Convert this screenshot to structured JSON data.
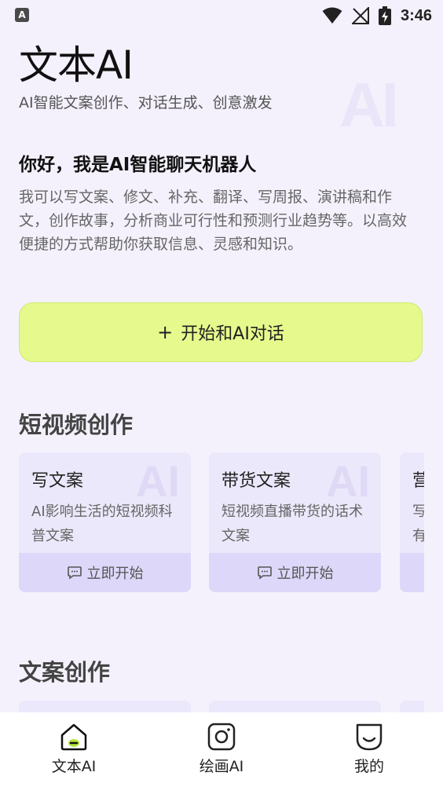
{
  "status_bar": {
    "app_icon": "A",
    "time": "3:46"
  },
  "header": {
    "title": "文本AI",
    "subtitle": "AI智能文案创作、对话生成、创意激发",
    "watermark": "AI"
  },
  "greeting": {
    "title": "你好，我是AI智能聊天机器人",
    "body": "我可以写文案、修文、补充、翻译、写周报、演讲稿和作文，创作故事，分析商业可行性和预测行业趋势等。以高效便捷的方式帮助你获取信息、灵感和知识。"
  },
  "start_chat": {
    "plus": "+",
    "label": "开始和AI对话"
  },
  "sections": [
    {
      "title": "短视频创作",
      "cards": [
        {
          "title": "写文案",
          "desc": "AI影响生活的短视频科普文案",
          "action": "立即开始"
        },
        {
          "title": "带货文案",
          "desc": "短视频直播带货的话术文案",
          "action": "立即开始"
        },
        {
          "title": "营",
          "desc": "写有",
          "action": ""
        }
      ]
    },
    {
      "title": "文案创作"
    }
  ],
  "bottom_nav": [
    {
      "label": "文本AI",
      "icon": "home-icon",
      "active": true
    },
    {
      "label": "绘画AI",
      "icon": "instagram-camera-icon",
      "active": false
    },
    {
      "label": "我的",
      "icon": "smile-face-icon",
      "active": false
    }
  ],
  "colors": {
    "background": "#F4F1FD",
    "accent": "#E6F98D",
    "card": "#ECE8FB",
    "card_action": "#DDD8F9",
    "active_dot": "#B5E43A"
  }
}
